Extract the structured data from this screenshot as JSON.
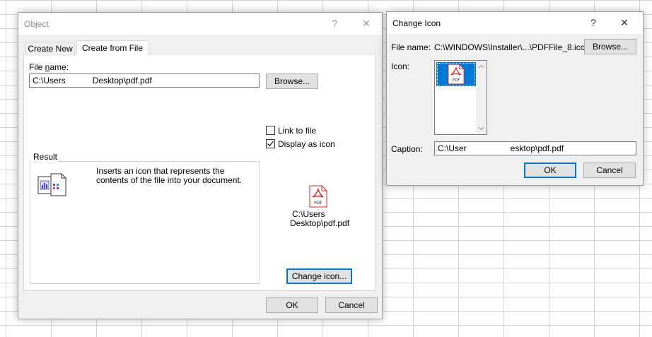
{
  "object_dialog": {
    "title": "Object",
    "help_glyph": "?",
    "close_glyph": "✕",
    "tabs": [
      {
        "label": "Create New"
      },
      {
        "label": "Create from File"
      }
    ],
    "file_name_label": "File name:",
    "file_name_mnemonic": "n",
    "file_name_value_part1": "C:\\Users",
    "file_name_value_part2": "Desktop\\pdf.pdf",
    "browse_label": "Browse...",
    "link_to_file_label": "Link to file",
    "display_as_icon_label": "Display as icon",
    "result_label": "Result",
    "result_text": "Inserts an icon that represents the contents of the file into your document.",
    "icon_caption_line1": "C:\\Users",
    "icon_caption_line2": "Desktop\\pdf.pdf",
    "change_icon_label": "Change icon...",
    "ok_label": "OK",
    "cancel_label": "Cancel",
    "link_to_file_checked": false,
    "display_as_icon_checked": true
  },
  "change_icon_dialog": {
    "title": "Change Icon",
    "help_glyph": "?",
    "close_glyph": "✕",
    "file_name_label": "File name:",
    "file_name_value": "C:\\WINDOWS\\Installer\\...\\PDFFile_8.ico",
    "browse_label": "Browse...",
    "icon_label": "Icon:",
    "caption_label": "Caption:",
    "caption_value_part1": "C:\\User",
    "caption_value_part2": "esktop\\pdf.pdf",
    "ok_label": "OK",
    "cancel_label": "Cancel",
    "pdf_badge": "PDF"
  },
  "colors": {
    "accent": "#0078d7",
    "pdf_red": "#e2231a"
  }
}
